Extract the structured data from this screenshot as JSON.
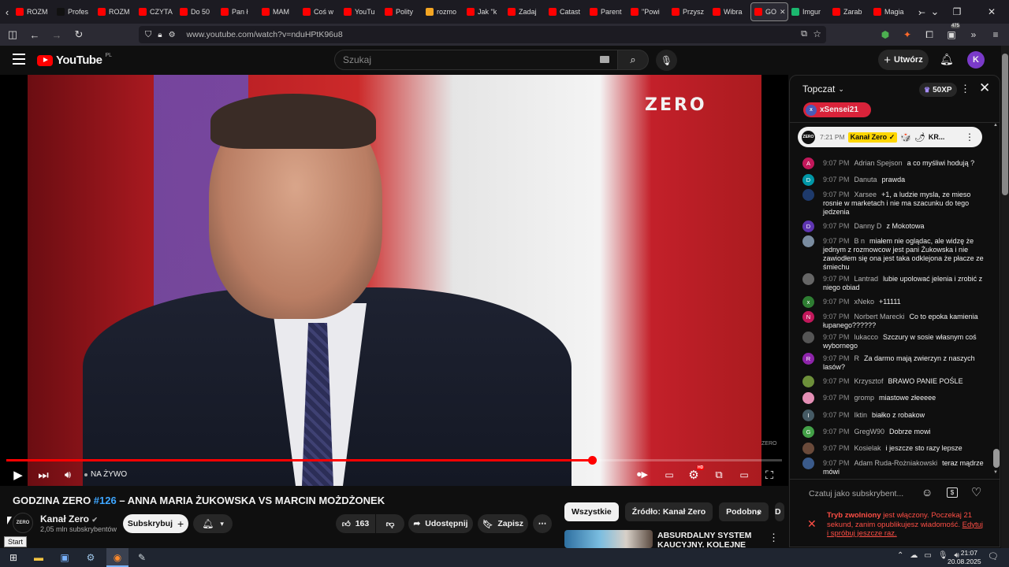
{
  "browser": {
    "tabs": [
      {
        "label": "ROZM",
        "color": "#ff0000"
      },
      {
        "label": "Profes",
        "color": "#111111"
      },
      {
        "label": "ROZM",
        "color": "#ff0000"
      },
      {
        "label": "CZYTA",
        "color": "#ff0000"
      },
      {
        "label": "Do 50",
        "color": "#ff0000"
      },
      {
        "label": "Pan ł",
        "color": "#ff0000"
      },
      {
        "label": "MAM",
        "color": "#ff0000"
      },
      {
        "label": "Coś w",
        "color": "#ff0000"
      },
      {
        "label": "YouTu",
        "color": "#ff0000"
      },
      {
        "label": "Polity",
        "color": "#ff0000"
      },
      {
        "label": "rozmo",
        "color": "#f5a623"
      },
      {
        "label": "Jak \"k",
        "color": "#ff0000"
      },
      {
        "label": "Zadaj",
        "color": "#ff0000"
      },
      {
        "label": "Catast",
        "color": "#ff0000"
      },
      {
        "label": "Parent",
        "color": "#ff0000"
      },
      {
        "label": "\"Powi",
        "color": "#ff0000"
      },
      {
        "label": "Przysz",
        "color": "#ff0000"
      },
      {
        "label": "Wibra",
        "color": "#ff0000"
      },
      {
        "label": "GO",
        "color": "#ff0000",
        "active": true
      },
      {
        "label": "Imgur",
        "color": "#1bb76e"
      },
      {
        "label": "Zarab",
        "color": "#ff0000"
      },
      {
        "label": "Magia",
        "color": "#ff0000"
      }
    ],
    "url": "www.youtube.com/watch?v=nduHPtK96u8",
    "badge_count": "475"
  },
  "youtube": {
    "logo_text": "YouTube",
    "region": "PL",
    "search_placeholder": "Szukaj",
    "create_label": "Utwórz",
    "avatar_letter": "K"
  },
  "player": {
    "watermark": "ZERO",
    "corner_watermark": "ZERO",
    "live_label": "NA ŻYWO",
    "progress": 0.755,
    "hd_badge": "HD"
  },
  "video": {
    "title_prefix": "GODZINA ZERO ",
    "title_tag": "#126",
    "title_rest": " – ANNA MARIA ŻUKOWSKA VS MARCIN MOŻDŻONEK",
    "channel": "Kanał Zero",
    "channel_logo": "ZERO",
    "subscribers": "2,05 mln subskrybentów",
    "subscribe_label": "Subskrybuj",
    "likes": "163",
    "share_label": "Udostępnij",
    "save_label": "Zapisz",
    "tooltip": "Start"
  },
  "filters": [
    "Wszystkie",
    "Źródło: Kanał Zero",
    "Podobne",
    "D"
  ],
  "recommendation": {
    "title": "ABSURDALNY SYSTEM KAUCYJNY. KOLEJNE"
  },
  "chat": {
    "mode": "Topczat",
    "xp": "50XP",
    "top_donor": "xSensei21",
    "top_donor_initial": "x",
    "pinned": {
      "time": "7:21 PM",
      "author": "Kanał Zero",
      "text": "KR...",
      "logo": "ZERO"
    },
    "messages": [
      {
        "initial": "A",
        "color": "#c2185b",
        "time": "9:07 PM",
        "author": "Adrian Spejson",
        "text": "a co myśliwi hodują ?"
      },
      {
        "initial": "D",
        "color": "#0097a7",
        "time": "9:07 PM",
        "author": "Danuta",
        "text": "prawda"
      },
      {
        "initial": "",
        "color": "#1e3a6b",
        "time": "9:07 PM",
        "author": "Xarsee",
        "text": "+1, a ludzie mysla, ze mieso rosnie w marketach i nie ma szacunku do tego jedzenia"
      },
      {
        "initial": "D",
        "color": "#5e35b1",
        "time": "9:07 PM",
        "author": "Danny D",
        "text": "z Mokotowa"
      },
      {
        "initial": "",
        "color": "#7a8ca0",
        "time": "9:07 PM",
        "author": "B n",
        "text": "miałem nie oglądac, ale widzę że jednym z rozmowcow jest pani Żukowska i nie zawiodłem się ona jest taka odklejona że płacze ze śmiechu"
      },
      {
        "initial": "",
        "color": "#666666",
        "time": "9:07 PM",
        "author": "Lantrad",
        "text": "lubie upolować jelenia i zrobić z niego obiad"
      },
      {
        "initial": "x",
        "color": "#2e7d32",
        "time": "9:07 PM",
        "author": "xNeko",
        "text": "+11111"
      },
      {
        "initial": "N",
        "color": "#c2185b",
        "time": "9:07 PM",
        "author": "Norbert Marecki",
        "text": "Co to epoka kamienia łupanego??????"
      },
      {
        "initial": "",
        "color": "#555555",
        "time": "9:07 PM",
        "author": "lukacco",
        "text": "Szczury w sosie własnym coś wybornego"
      },
      {
        "initial": "R",
        "color": "#8e24aa",
        "time": "9:07 PM",
        "author": "R",
        "text": "Za darmo mają zwierzyn z naszych lasów?"
      },
      {
        "initial": "",
        "color": "#6d8f3a",
        "time": "9:07 PM",
        "author": "Krzysztof",
        "text": "BRAWO PANIE POŚLE"
      },
      {
        "initial": "",
        "color": "#e48fb5",
        "time": "9:07 PM",
        "author": "gromp",
        "text": "miastowe złeeeee"
      },
      {
        "initial": "I",
        "color": "#455a64",
        "time": "9:07 PM",
        "author": "Iktin",
        "text": "białko z robakow"
      },
      {
        "initial": "G",
        "color": "#43a047",
        "time": "9:07 PM",
        "author": "GregW90",
        "text": "Dobrze mowi"
      },
      {
        "initial": "",
        "color": "#6a4a3a",
        "time": "9:07 PM",
        "author": "Kosielak",
        "text": "i jeszcze sto razy lepsze"
      },
      {
        "initial": "",
        "color": "#3a5a8a",
        "time": "9:07 PM",
        "author": "Adam Ruda-Rożniakowski",
        "text": "teraz mądrze mówi"
      }
    ],
    "input_placeholder": "Czatuj jako subskrybent...",
    "error_bold": "Tryb zwolniony",
    "error_text": " jest włączony. Poczekaj 21 sekund, zanim opublikujesz wiadomość.",
    "error_link": "Edytuj i spróbuj jeszcze raz."
  },
  "taskbar": {
    "time": "21:07",
    "date": "20.08.2025"
  }
}
